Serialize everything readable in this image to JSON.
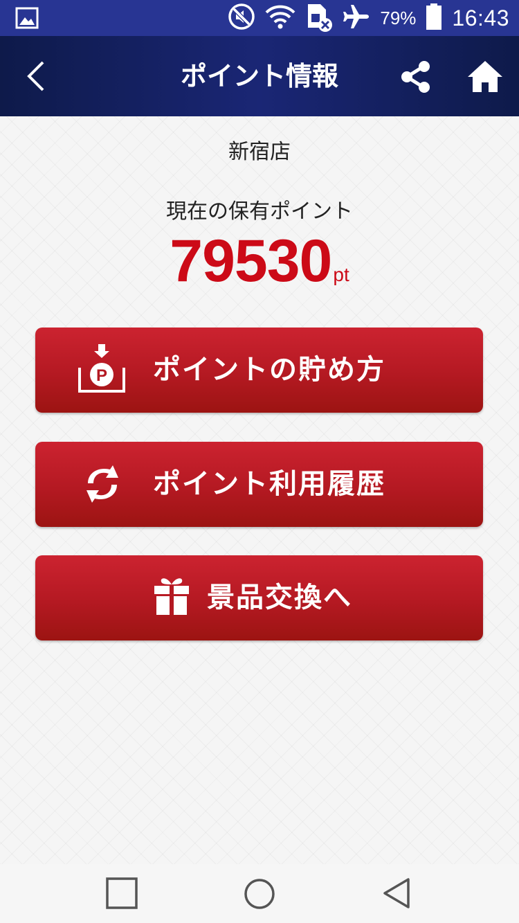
{
  "status_bar": {
    "battery_text": "79%",
    "time": "16:43"
  },
  "header": {
    "title": "ポイント情報"
  },
  "store": {
    "name": "新宿店"
  },
  "points": {
    "label": "現在の保有ポイント",
    "value": "79530",
    "unit": "pt"
  },
  "menu": {
    "save_points_label": "ポイントの貯め方",
    "history_label": "ポイント利用履歴",
    "exchange_label": "景品交換へ"
  },
  "colors": {
    "status_bar": "#283593",
    "header": "#1a2675",
    "accent_red": "#cc0a17",
    "button_red": "#b41922"
  },
  "icons": [
    "image-icon",
    "mute-icon",
    "wifi-icon",
    "sim-icon",
    "airplane-icon",
    "battery-icon",
    "back-arrow-icon",
    "share-icon",
    "home-icon",
    "point-deposit-icon",
    "refresh-arrows-icon",
    "gift-icon",
    "recent-apps-icon",
    "home-circle-icon",
    "back-triangle-icon"
  ]
}
